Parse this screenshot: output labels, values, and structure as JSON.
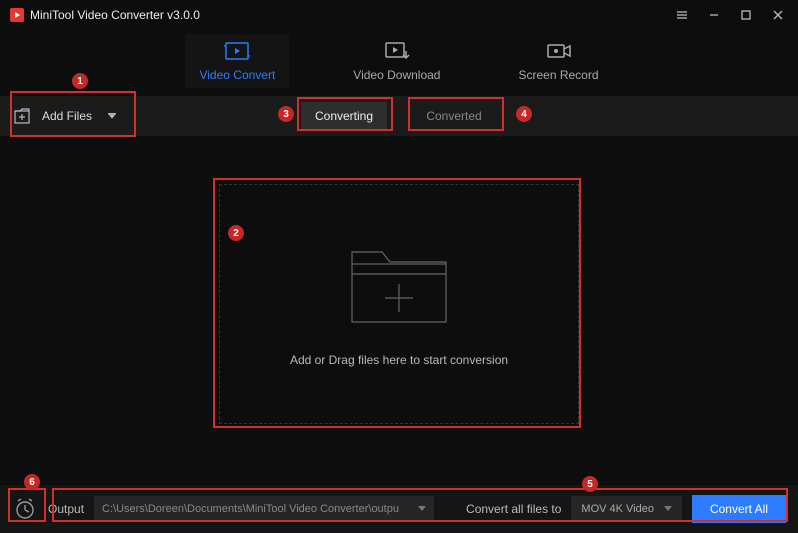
{
  "titlebar": {
    "title": "MiniTool Video Converter v3.0.0"
  },
  "topTabs": {
    "convert": "Video Convert",
    "download": "Video Download",
    "record": "Screen Record"
  },
  "toolbar": {
    "addFiles": "Add Files",
    "converting": "Converting",
    "converted": "Converted"
  },
  "dropzone": {
    "text": "Add or Drag files here to start conversion"
  },
  "bottom": {
    "outputLabel": "Output",
    "outputPath": "C:\\Users\\Doreen\\Documents\\MiniTool Video Converter\\outpu",
    "convertAllLabel": "Convert all files to",
    "formatSelected": "MOV 4K Video",
    "convertAll": "Convert All"
  },
  "annotations": {
    "1": "1",
    "2": "2",
    "3": "3",
    "4": "4",
    "5": "5",
    "6": "6"
  }
}
